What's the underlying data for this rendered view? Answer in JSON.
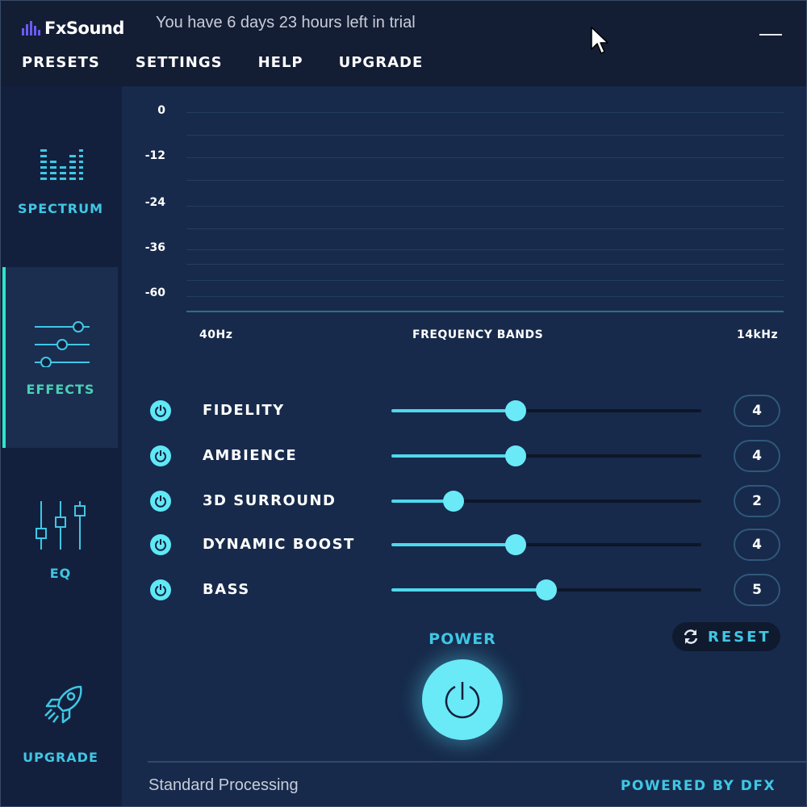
{
  "app": {
    "brand": "FxSound",
    "trial_notice": "You have 6 days 23 hours left in trial"
  },
  "menu": [
    {
      "label": "PRESETS"
    },
    {
      "label": "SETTINGS"
    },
    {
      "label": "HELP"
    },
    {
      "label": "UPGRADE"
    }
  ],
  "sidebar": {
    "items": [
      {
        "label": "SPECTRUM",
        "icon": "spectrum-icon"
      },
      {
        "label": "EFFECTS",
        "icon": "sliders-icon",
        "active": true
      },
      {
        "label": "EQ",
        "icon": "eq-icon"
      },
      {
        "label": "UPGRADE",
        "icon": "rocket-icon"
      }
    ]
  },
  "spectrum": {
    "y_ticks": [
      "0",
      "-12",
      "-24",
      "-36",
      "-60"
    ],
    "x_start": "40Hz",
    "x_title": "FREQUENCY BANDS",
    "x_end": "14kHz"
  },
  "effects": [
    {
      "name": "FIDELITY",
      "value": "4",
      "level": 4,
      "max": 10
    },
    {
      "name": "AMBIENCE",
      "value": "4",
      "level": 4,
      "max": 10
    },
    {
      "name": "3D SURROUND",
      "value": "2",
      "level": 2,
      "max": 10
    },
    {
      "name": "DYNAMIC BOOST",
      "value": "4",
      "level": 4,
      "max": 10
    },
    {
      "name": "BASS",
      "value": "5",
      "level": 5,
      "max": 10
    }
  ],
  "controls": {
    "power_label": "POWER",
    "reset_label": "RESET"
  },
  "footer": {
    "status": "Standard Processing",
    "powered_by": "POWERED BY DFX"
  },
  "colors": {
    "accent": "#3fc7e4",
    "active": "#4ad0b4",
    "brand": "#6a5cf0",
    "background": "#172a4b"
  }
}
